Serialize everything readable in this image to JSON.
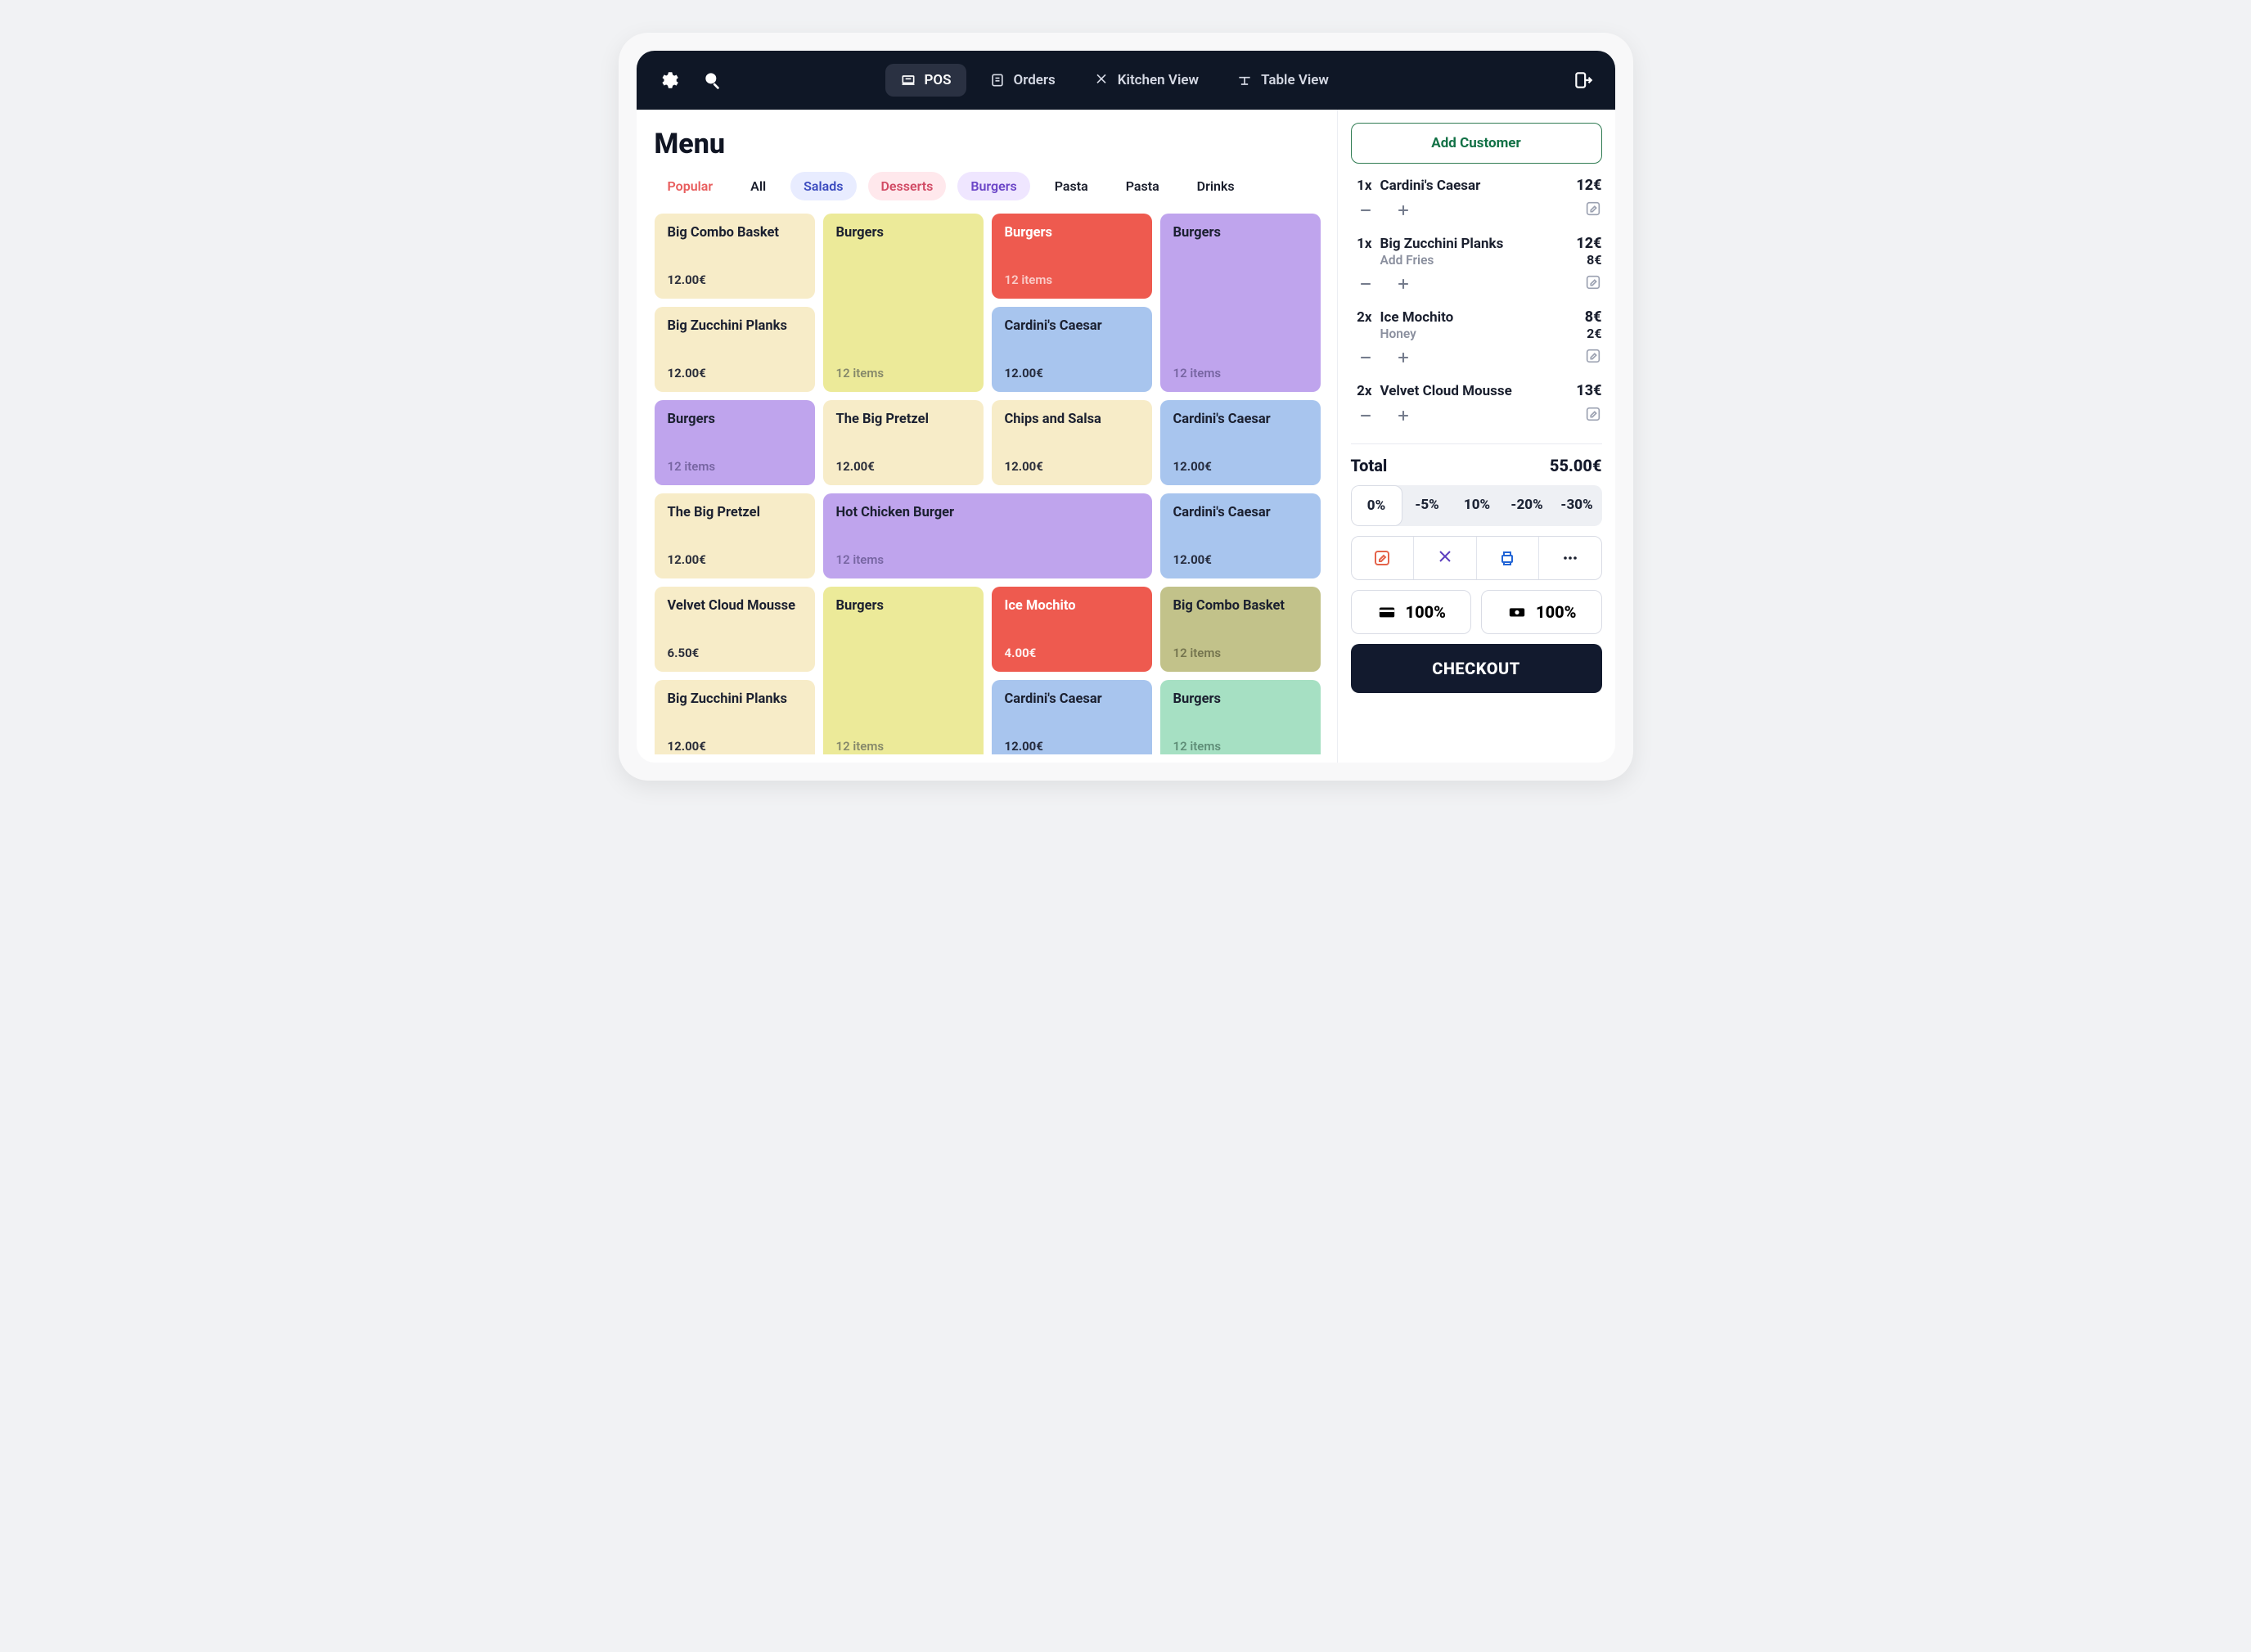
{
  "nav": {
    "pos": "POS",
    "orders": "Orders",
    "kitchen": "Kitchen View",
    "table": "Table View"
  },
  "menu": {
    "title": "Menu",
    "tabs": {
      "popular": "Popular",
      "all": "All",
      "salads": "Salads",
      "desserts": "Desserts",
      "burgers": "Burgers",
      "pasta1": "Pasta",
      "pasta2": "Pasta",
      "drinks": "Drinks"
    },
    "cards": {
      "c0": {
        "title": "Big Combo Basket",
        "sub": "12.00€",
        "subKind": "price"
      },
      "c1": {
        "title": "Burgers",
        "sub": "12 items",
        "subKind": "items"
      },
      "c2": {
        "title": "Burgers",
        "sub": "12 items",
        "subKind": "items"
      },
      "c3": {
        "title": "Burgers",
        "sub": "12 items",
        "subKind": "items"
      },
      "c4": {
        "title": "Big Zucchini Planks",
        "sub": "12.00€",
        "subKind": "price"
      },
      "c5": {
        "title": "Cardini's Caesar",
        "sub": "12.00€",
        "subKind": "price"
      },
      "c6": {
        "title": "Burgers",
        "sub": "12 items",
        "subKind": "items"
      },
      "c7": {
        "title": "The Big Pretzel",
        "sub": "12.00€",
        "subKind": "price"
      },
      "c8": {
        "title": "Chips and Salsa",
        "sub": "12.00€",
        "subKind": "price"
      },
      "c9": {
        "title": "Cardini's Caesar",
        "sub": "12.00€",
        "subKind": "price"
      },
      "c10": {
        "title": "The Big Pretzel",
        "sub": "12.00€",
        "subKind": "price"
      },
      "c11": {
        "title": "Hot Chicken Burger",
        "sub": "12 items",
        "subKind": "items"
      },
      "c12": {
        "title": "Cardini's Caesar",
        "sub": "12.00€",
        "subKind": "price"
      },
      "c13": {
        "title": "Velvet Cloud Mousse",
        "sub": "6.50€",
        "subKind": "price"
      },
      "c14": {
        "title": "Burgers",
        "sub": "12 items",
        "subKind": "items"
      },
      "c15": {
        "title": "Ice Mochito",
        "sub": "4.00€",
        "subKind": "price"
      },
      "c16": {
        "title": "Big Combo Basket",
        "sub": "12 items",
        "subKind": "items"
      },
      "c17": {
        "title": "Big Zucchini Planks",
        "sub": "12.00€",
        "subKind": "price"
      },
      "c18": {
        "title": "Cardini's Caesar",
        "sub": "12.00€",
        "subKind": "price"
      },
      "c19": {
        "title": "Burgers",
        "sub": "12 items",
        "subKind": "items"
      }
    }
  },
  "cart": {
    "addCustomer": "Add Customer",
    "lines": {
      "l0": {
        "qty": "1x",
        "name": "Cardini's Caesar",
        "price": "12€"
      },
      "l1": {
        "qty": "1x",
        "name": "Big Zucchini Planks",
        "price": "12€",
        "modName": "Add Fries",
        "modPrice": "8€"
      },
      "l2": {
        "qty": "2x",
        "name": "Ice Mochito",
        "price": "8€",
        "modName": "Honey",
        "modPrice": "2€"
      },
      "l3": {
        "qty": "2x",
        "name": "Velvet Cloud Mousse",
        "price": "13€"
      }
    },
    "totalLabel": "Total",
    "totalValue": "55.00€",
    "discounts": {
      "d0": "0%",
      "d1": "-5%",
      "d2": "10%",
      "d3": "-20%",
      "d4": "-30%"
    },
    "pay": {
      "card": "100%",
      "cash": "100%"
    },
    "checkout": "CHECKOUT"
  }
}
